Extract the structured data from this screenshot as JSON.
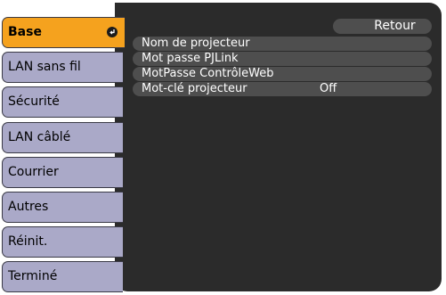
{
  "sidebar": {
    "items": [
      {
        "label": "Base",
        "active": true
      },
      {
        "label": "LAN sans fil"
      },
      {
        "label": "Sécurité"
      },
      {
        "label": "LAN câblé"
      },
      {
        "label": "Courrier"
      },
      {
        "label": "Autres"
      },
      {
        "label": "Réinit."
      },
      {
        "label": "Terminé"
      }
    ]
  },
  "main": {
    "back_label": "Retour",
    "rows": [
      {
        "label": "Nom de projecteur",
        "value": ""
      },
      {
        "label": "Mot passe PJLink",
        "value": ""
      },
      {
        "label": "MotPasse ContrôleWeb",
        "value": ""
      },
      {
        "label": "Mot-clé projecteur",
        "value": "Off"
      }
    ]
  },
  "colors": {
    "active_tab": "#f5a21e",
    "inactive_tab": "#aaa9c8",
    "panel": "#2b2b2b",
    "row": "#4e4e4e"
  },
  "icons": {
    "enter": "enter-return-icon"
  }
}
